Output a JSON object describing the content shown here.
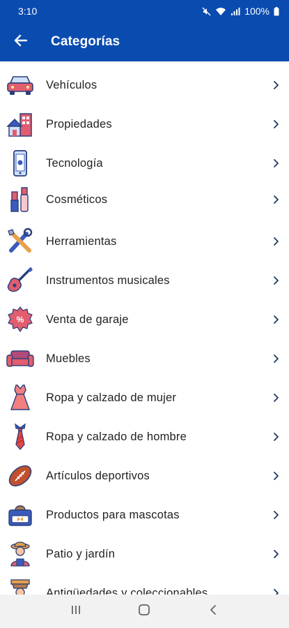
{
  "status_bar": {
    "time": "3:10",
    "battery": "100%",
    "icons": [
      "mute-icon",
      "wifi-icon",
      "signal-icon",
      "battery-icon"
    ]
  },
  "app_bar": {
    "title": "Categorías",
    "back_icon": "arrow-left-icon"
  },
  "categories": [
    {
      "label": "Vehículos",
      "icon": "car-icon"
    },
    {
      "label": "Propiedades",
      "icon": "house-icon"
    },
    {
      "label": "Tecnología",
      "icon": "smartphone-icon"
    },
    {
      "label": "Cosméticos",
      "icon": "cosmetics-icon"
    },
    {
      "label": "Herramientas",
      "icon": "tools-icon"
    },
    {
      "label": "Instrumentos musicales",
      "icon": "guitar-icon"
    },
    {
      "label": "Venta de garaje",
      "icon": "percent-badge-icon"
    },
    {
      "label": "Muebles",
      "icon": "sofa-icon"
    },
    {
      "label": "Ropa y calzado de mujer",
      "icon": "dress-icon"
    },
    {
      "label": "Ropa y calzado de hombre",
      "icon": "tie-icon"
    },
    {
      "label": "Artículos deportivos",
      "icon": "football-icon"
    },
    {
      "label": "Productos para mascotas",
      "icon": "pet-bed-icon"
    },
    {
      "label": "Patio y jardín",
      "icon": "gardener-icon"
    },
    {
      "label": "Antigüedades y coleccionables",
      "icon": "antique-icon"
    }
  ],
  "nav_bar": {
    "icons": [
      "recent-apps-icon",
      "home-icon",
      "back-icon"
    ]
  },
  "colors": {
    "primary": "#0a4bb0",
    "chevron": "#1c3a5e",
    "icon_blue": "#3a5bbd",
    "icon_pink": "#e25d6e",
    "icon_red": "#e04848"
  }
}
